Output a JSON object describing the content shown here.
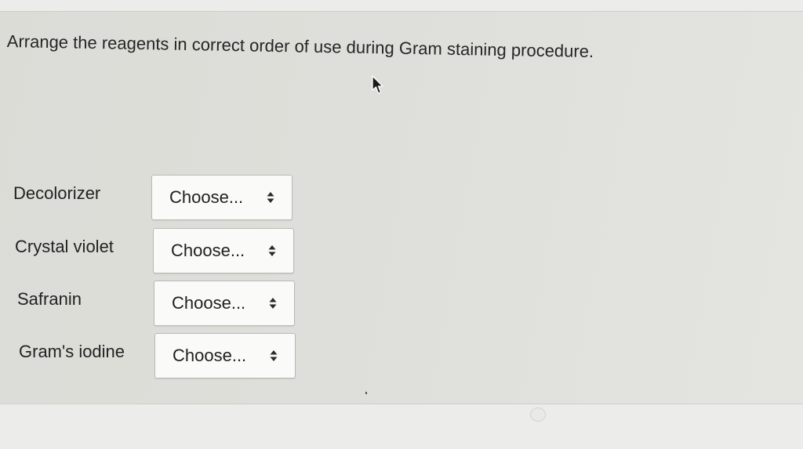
{
  "question": "Arrange the reagents in correct order of use during Gram staining procedure.",
  "rows": [
    {
      "label": "Decolorizer",
      "select_value": "Choose..."
    },
    {
      "label": "Crystal violet",
      "select_value": "Choose..."
    },
    {
      "label": "Safranin",
      "select_value": "Choose..."
    },
    {
      "label": "Gram's iodine",
      "select_value": "Choose..."
    }
  ],
  "icons": {
    "pointer": "mouse-pointer-icon",
    "select_arrows": "up-down-arrows-icon"
  },
  "colors": {
    "panel_background": "#dededa",
    "select_background": "#fafaf9",
    "select_border": "#b9b9b5",
    "text": "#222222"
  }
}
